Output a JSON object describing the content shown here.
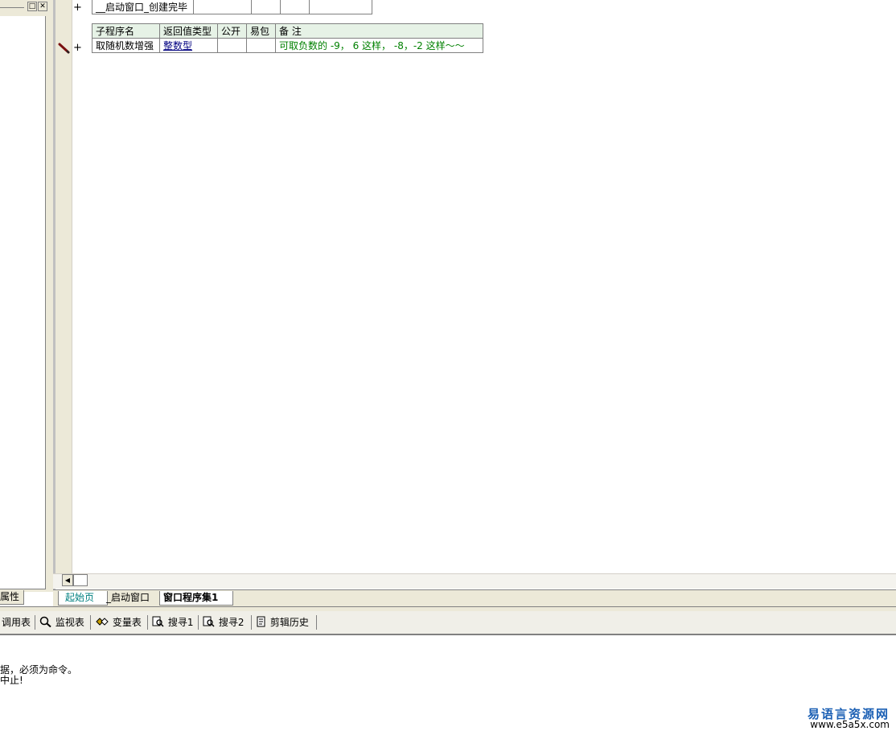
{
  "left_panel": {
    "restore_glyph": "□",
    "close_glyph": "✕",
    "tab_label": "属性"
  },
  "event_table": {
    "plus": "+",
    "row": [
      "__启动窗口_创建完毕",
      "",
      "",
      "",
      ""
    ]
  },
  "sub_table": {
    "plus": "+",
    "headers": [
      "子程序名",
      "返回值类型",
      "公开",
      "易包",
      "备 注"
    ],
    "row": {
      "name": "取随机数增强",
      "return_type": "整数型",
      "public": "",
      "package": "",
      "remark": "可取负数的 -9， 6  这样， -8，-2 这样～～"
    }
  },
  "tabs": [
    "起始页",
    "_启动窗口",
    "窗口程序集1"
  ],
  "toolbar": {
    "call_table": "调用表",
    "watch": "监视表",
    "variables": "变量表",
    "search1": "搜寻1",
    "search2": "搜寻2",
    "clip_history": "剪辑历史"
  },
  "output": {
    "line1": "据，必须为命令。",
    "line2": "中止!"
  },
  "watermark": {
    "title": "易语言资源网",
    "url": "www.e5a5x.com"
  },
  "colors": {
    "header_bg": "#e6f2e6",
    "link": "#000080",
    "remark": "#008000",
    "watermark": "#1a5fb4"
  }
}
